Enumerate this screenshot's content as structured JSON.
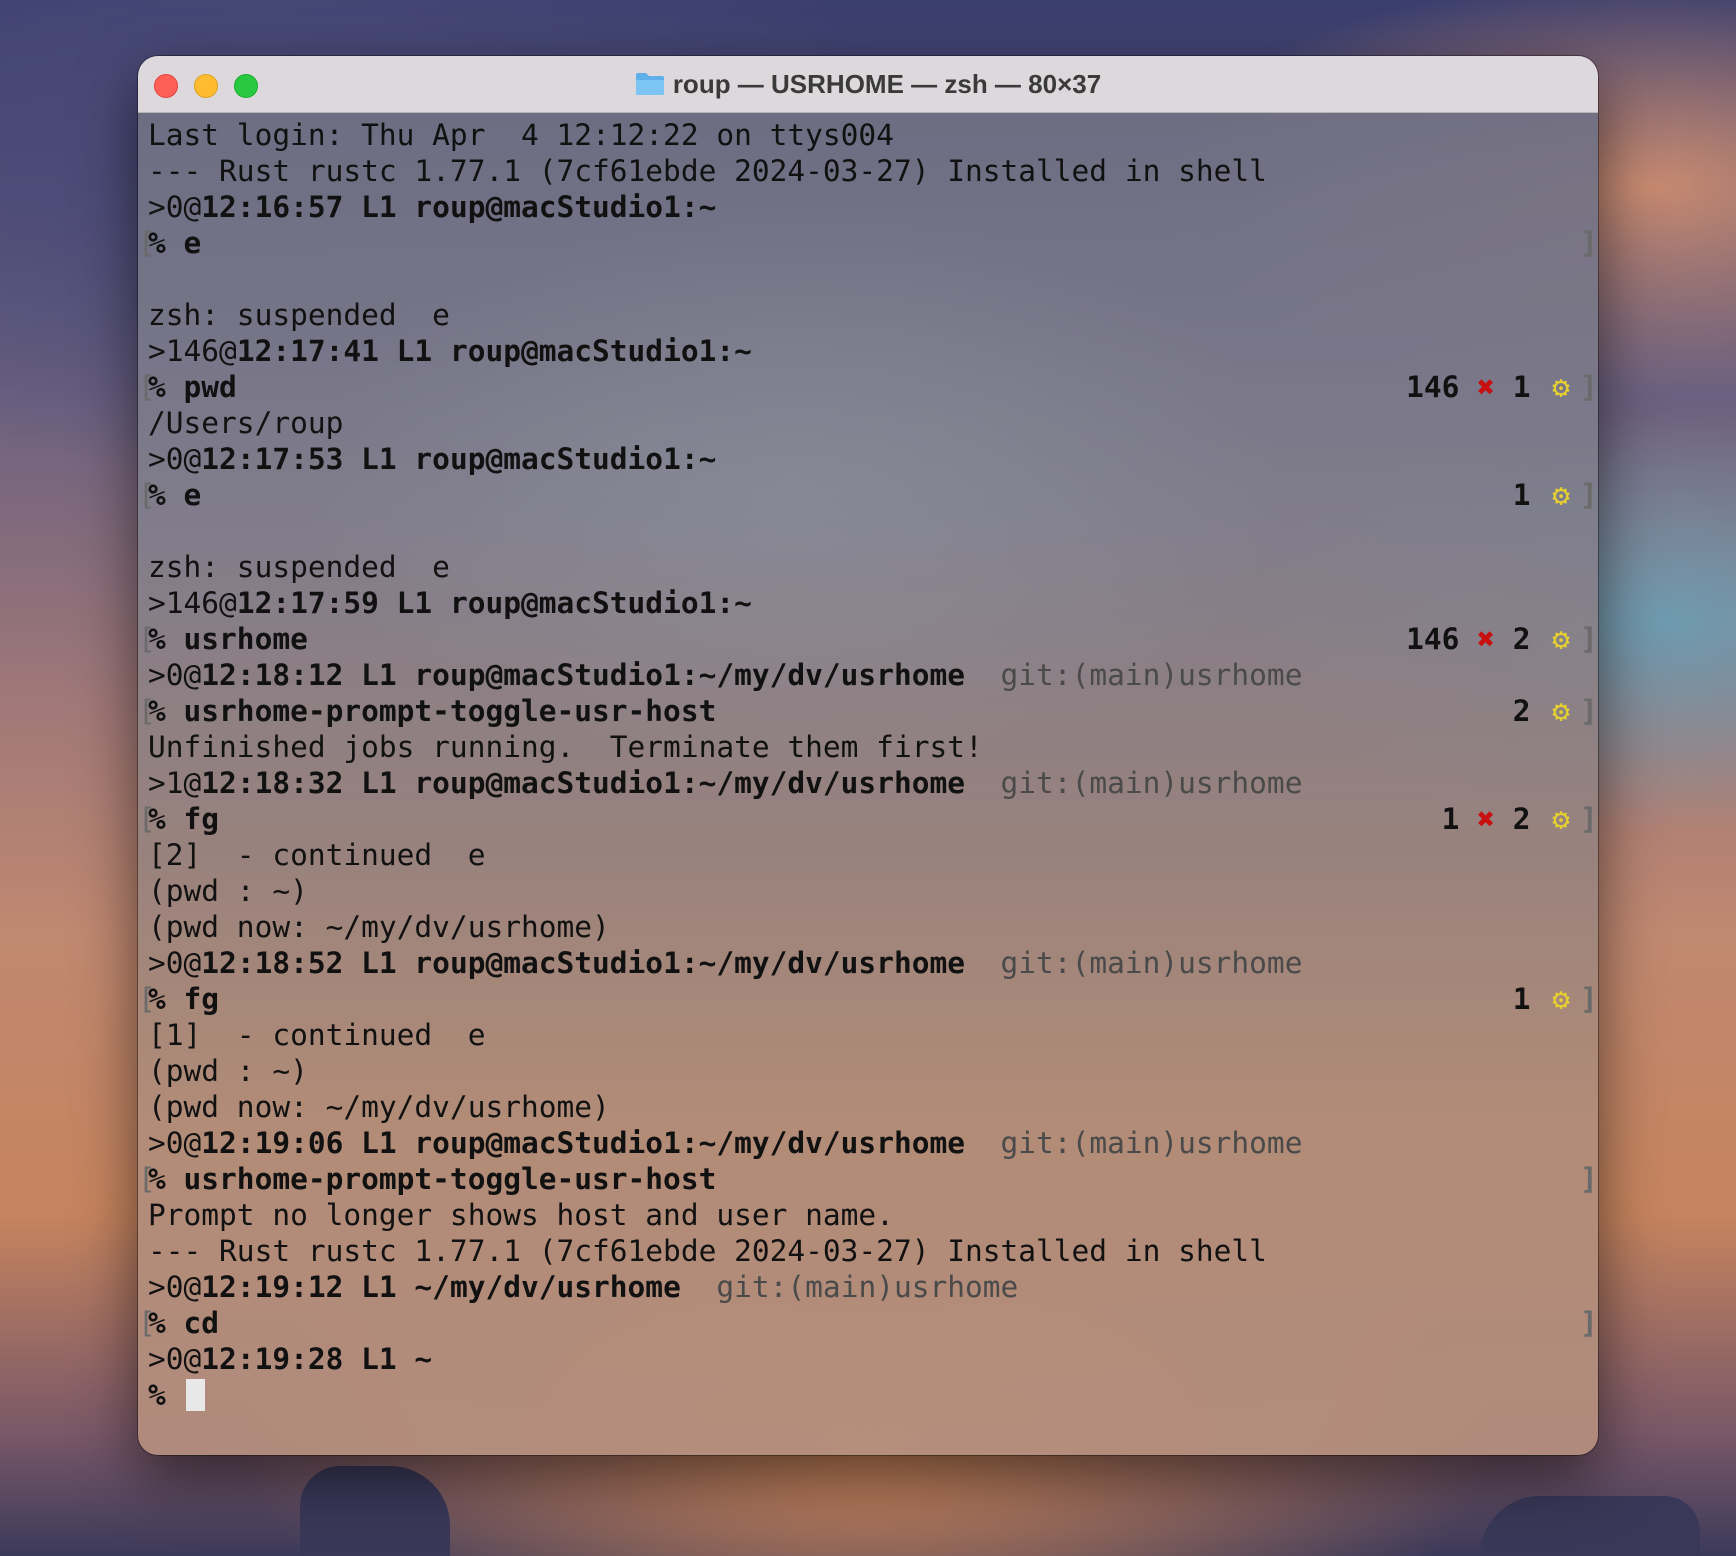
{
  "window": {
    "title": "roup — USRHOME — zsh — 80×37",
    "folder_icon": "folder-icon"
  },
  "colors": {
    "error_x": "#c81010",
    "gear": "#e6d030",
    "git_text": "#4a4a4a"
  },
  "terminal": {
    "line01": "Last login: Thu Apr  4 12:12:22 on ttys004",
    "line02": "--- Rust rustc 1.77.1 (7cf61ebde 2024-03-27) Installed in shell",
    "p1": {
      "status": ">0@",
      "rest": "12:16:57 L1 roup@macStudio1:~"
    },
    "c1": {
      "cmd": "% e"
    },
    "line05": "",
    "line06": "zsh: suspended  e",
    "p2": {
      "status": ">146@",
      "rest": "12:17:41 L1 roup@macStudio1:~"
    },
    "c2": {
      "cmd": "% pwd",
      "code": "146 ",
      "x": "✖",
      "jobs": " 1 ",
      "gear": "⚙"
    },
    "line09": "/Users/roup",
    "p3": {
      "status": ">0@",
      "rest": "12:17:53 L1 roup@macStudio1:~"
    },
    "c3": {
      "cmd": "% e",
      "jobs": "1 ",
      "gear": "⚙"
    },
    "line12": "",
    "line13": "zsh: suspended  e",
    "p4": {
      "status": ">146@",
      "rest": "12:17:59 L1 roup@macStudio1:~"
    },
    "c4": {
      "cmd": "% usrhome",
      "code": "146 ",
      "x": "✖",
      "jobs": " 2 ",
      "gear": "⚙"
    },
    "p5": {
      "status": ">0@",
      "rest": "12:18:12 L1 roup@macStudio1:~/my/dv/usrhome",
      "git": "  git:(main)usrhome"
    },
    "c5": {
      "cmd": "% usrhome-prompt-toggle-usr-host",
      "jobs": "2 ",
      "gear": "⚙"
    },
    "line18": "Unfinished jobs running.  Terminate them first!",
    "p6": {
      "status": ">1@",
      "rest": "12:18:32 L1 roup@macStudio1:~/my/dv/usrhome",
      "git": "  git:(main)usrhome"
    },
    "c6": {
      "cmd": "% fg",
      "code": "1 ",
      "x": "✖",
      "jobs": " 2 ",
      "gear": "⚙"
    },
    "line21": "[2]  - continued  e",
    "line22": "(pwd : ~)",
    "line23": "(pwd now: ~/my/dv/usrhome)",
    "p7": {
      "status": ">0@",
      "rest": "12:18:52 L1 roup@macStudio1:~/my/dv/usrhome",
      "git": "  git:(main)usrhome"
    },
    "c7": {
      "cmd": "% fg",
      "jobs": "1 ",
      "gear": "⚙"
    },
    "line26": "[1]  - continued  e",
    "line27": "(pwd : ~)",
    "line28": "(pwd now: ~/my/dv/usrhome)",
    "p8": {
      "status": ">0@",
      "rest": "12:19:06 L1 roup@macStudio1:~/my/dv/usrhome",
      "git": "  git:(main)usrhome"
    },
    "c8": {
      "cmd": "% usrhome-prompt-toggle-usr-host"
    },
    "line31": "Prompt no longer shows host and user name.",
    "line32": "--- Rust rustc 1.77.1 (7cf61ebde 2024-03-27) Installed in shell",
    "p9": {
      "status": ">0@",
      "rest": "12:19:12 L1 ~/my/dv/usrhome",
      "git": "  git:(main)usrhome"
    },
    "c9": {
      "cmd": "% cd"
    },
    "p10": {
      "status": ">0@",
      "rest": "12:19:28 L1 ~"
    },
    "input": {
      "prompt": "% ",
      "value": ""
    }
  }
}
